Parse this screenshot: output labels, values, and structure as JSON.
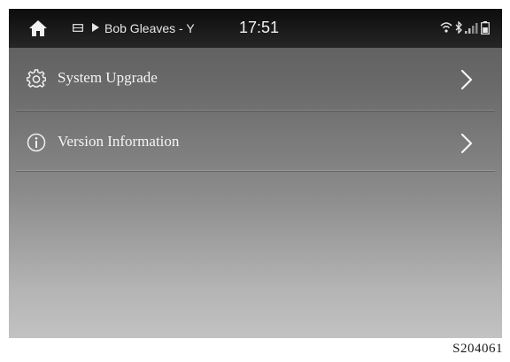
{
  "status_bar": {
    "now_playing": "Bob Gleaves - Y",
    "time": "17:51",
    "icons": [
      "home-icon",
      "media-source-icon",
      "play-icon",
      "wifi-icon",
      "bluetooth-icon",
      "signal-icon",
      "battery-icon"
    ]
  },
  "menu": {
    "items": [
      {
        "label": "System Upgrade",
        "icon": "gear-icon"
      },
      {
        "label": "Version Information",
        "icon": "info-icon"
      }
    ]
  },
  "figure_code": "S204061",
  "colors": {
    "status_bar_bg": "#141414",
    "screen_top": "#595959",
    "screen_bottom": "#c2c2c2",
    "text": "#f4f4f4"
  }
}
